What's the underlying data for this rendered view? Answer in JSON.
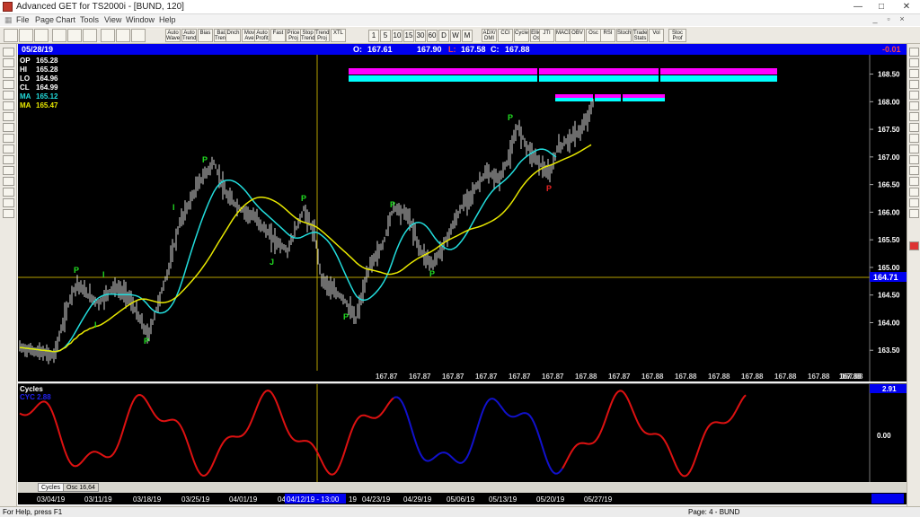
{
  "window": {
    "title": "Advanced GET for TS2000i - [BUND, 120]",
    "minimize_label": "—",
    "maximize_label": "□",
    "close_label": "✕"
  },
  "menu": {
    "items": [
      "File",
      "Page",
      "Chart",
      "Tools",
      "View",
      "Window",
      "Help"
    ],
    "mdi_controls": [
      "_",
      "▫",
      "×"
    ]
  },
  "toolbar": {
    "buttons": [
      "Auto Wave",
      "Auto Trend",
      "Bias",
      "Bal. Trend",
      "Dnch",
      "Mov Ave",
      "Auto Profit",
      "Fast",
      "Price Proj",
      "Stop Trend",
      "Trend Proj",
      "XTL"
    ],
    "intervals": [
      "1",
      "5",
      "10",
      "15",
      "30",
      "60",
      "D",
      "W",
      "M"
    ],
    "indicators": [
      "ADX/ DMI",
      "CCI",
      "Cycles",
      "Elliott Osc",
      "JTI",
      "MACD",
      "OBV",
      "Osc",
      "RSI",
      "Stoch",
      "Trade Stats",
      "Vol",
      "Stoc Prof"
    ]
  },
  "infobar": {
    "date": "05/28/19",
    "open_label": "O:",
    "open": "167.61",
    "high": "167.90",
    "low_marker": "L:",
    "low": "167.58",
    "close_label": "C:",
    "close": "167.88",
    "change": "-0.01"
  },
  "data_window": {
    "op_label": "OP",
    "op": "165.28",
    "hi_label": "HI",
    "hi": "165.28",
    "lo_label": "LO",
    "lo": "164.96",
    "cl_label": "CL",
    "cl": "164.99",
    "ma1_label": "MA",
    "ma1": "165.12",
    "ma2_label": "MA",
    "ma2": "165.47"
  },
  "price_axis": {
    "ticks": [
      "168.50",
      "168.00",
      "167.50",
      "167.00",
      "166.50",
      "166.00",
      "165.50",
      "165.00",
      "164.50",
      "164.00",
      "163.50"
    ],
    "highlight": "164.71",
    "current": "167.88"
  },
  "projection_labels": [
    "167.87",
    "167.87",
    "167.87",
    "167.87",
    "167.87",
    "167.87",
    "167.88",
    "167.87",
    "167.88",
    "167.88",
    "167.88",
    "167.88",
    "167.88",
    "167.88",
    "167.88"
  ],
  "markers": [
    {
      "label": "P",
      "color": "#22dd22"
    },
    {
      "label": "I",
      "color": "#22dd22"
    },
    {
      "label": "I",
      "color": "#22dd22"
    },
    {
      "label": "P",
      "color": "#22dd22"
    },
    {
      "label": "I",
      "color": "#22dd22"
    },
    {
      "label": "P",
      "color": "#22dd22"
    },
    {
      "label": "P",
      "color": "#22dd22"
    },
    {
      "label": "J",
      "color": "#22dd22"
    },
    {
      "label": "P",
      "color": "#22dd22"
    },
    {
      "label": "P",
      "color": "#22dd22"
    },
    {
      "label": "P",
      "color": "#22dd22"
    },
    {
      "label": "P",
      "color": "#22dd22"
    },
    {
      "label": "P",
      "color": "#ee2222"
    }
  ],
  "oscillator": {
    "title": "Cycles",
    "cyc_label": "CYC 2.88",
    "top_value": "2.91",
    "zero_label": "0.00"
  },
  "tabs": [
    "Cycles",
    "Osc 16,64"
  ],
  "date_axis": {
    "labels": [
      "03/04/19",
      "03/11/19",
      "03/18/19",
      "03/25/19",
      "04/01/19",
      "04",
      "04/12/19 - 13:00",
      "19",
      "04/23/19",
      "04/29/19",
      "05/06/19",
      "05/13/19",
      "05/20/19",
      "05/27/19"
    ]
  },
  "status": {
    "help": "For Help, press F1",
    "page": "Page: 4 - BUND"
  },
  "colors": {
    "infobar": "#0000ee",
    "ma_fast": "#22dddd",
    "ma_slow": "#e8e800",
    "cycle_red": "#dd1111",
    "cycle_blue": "#1111cc",
    "projection_magenta": "#ff00ff",
    "projection_cyan": "#00ffff"
  }
}
